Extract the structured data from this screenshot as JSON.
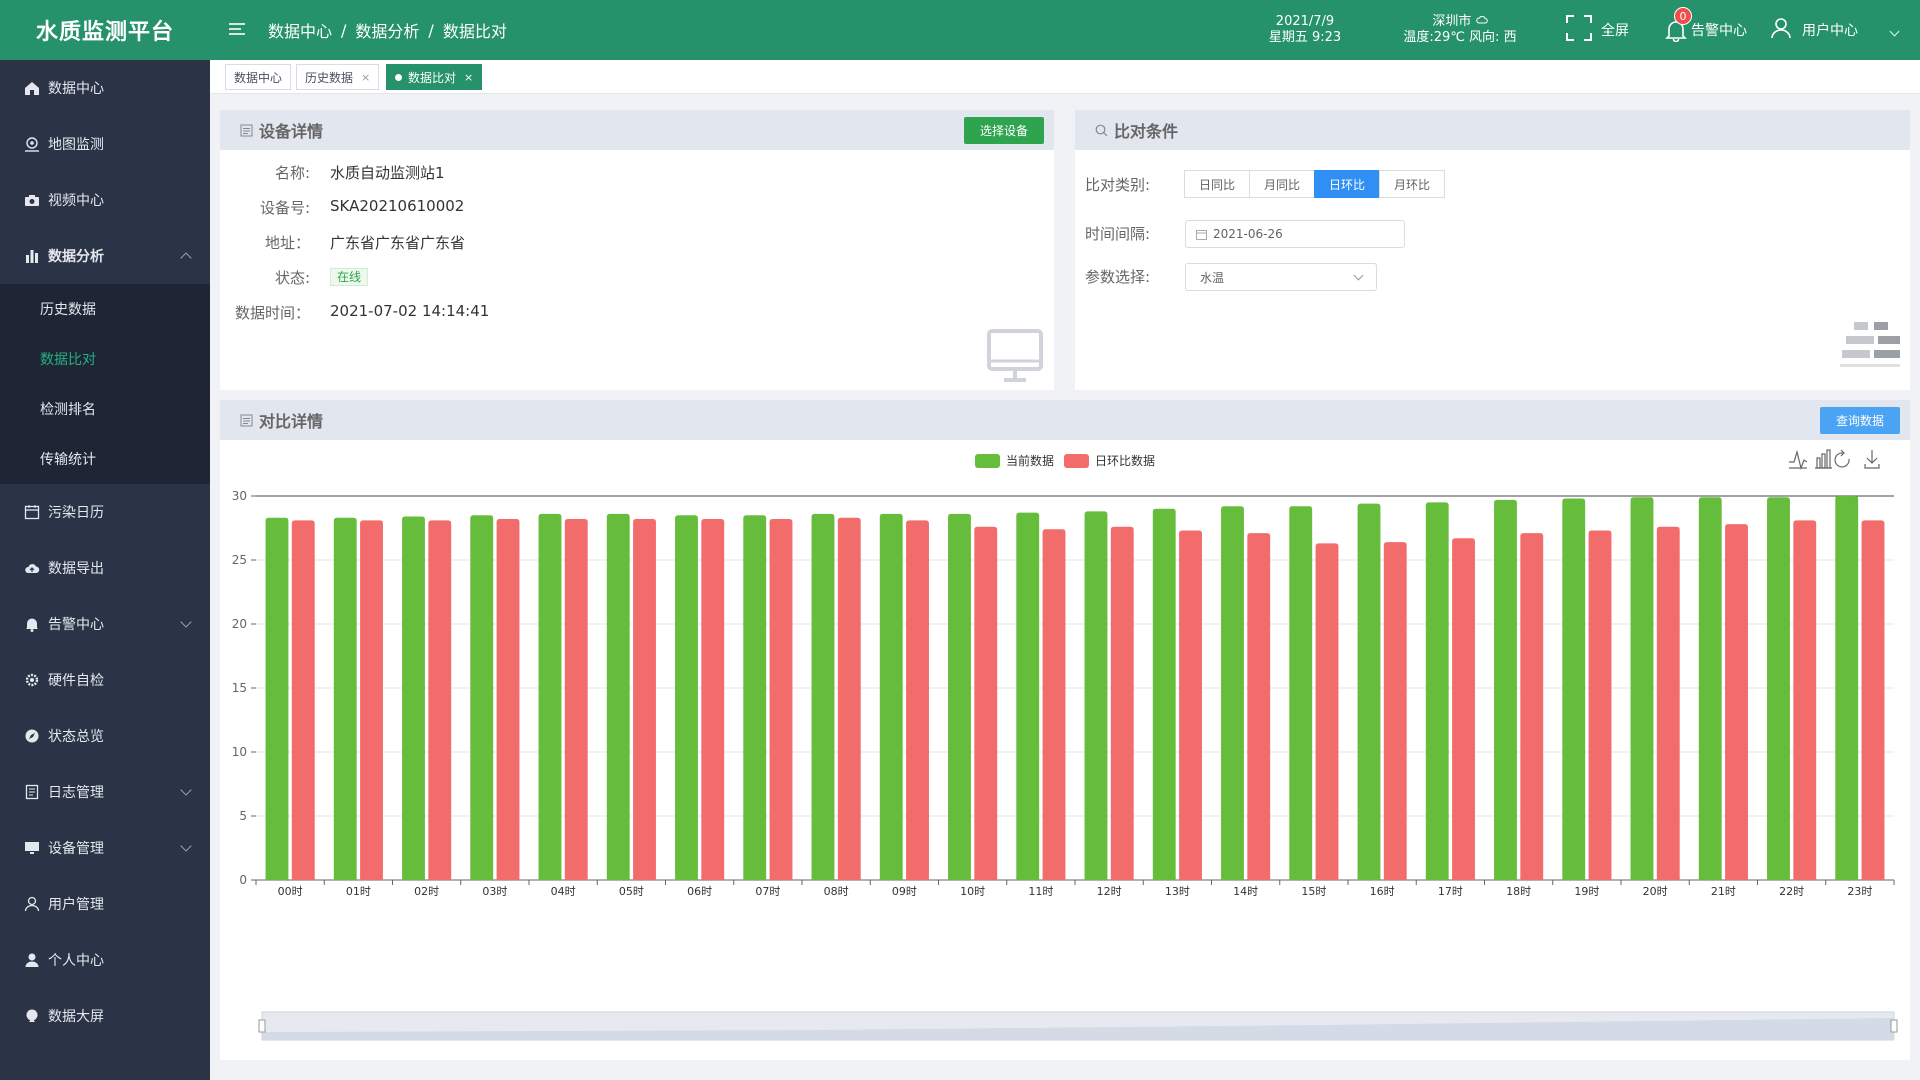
{
  "app": {
    "title": "水质监测平台"
  },
  "sidebar": {
    "items": [
      {
        "label": "数据中心",
        "icon": "home-icon"
      },
      {
        "label": "地图监测",
        "icon": "map-pin-icon"
      },
      {
        "label": "视频中心",
        "icon": "camera-icon"
      },
      {
        "label": "数据分析",
        "icon": "bar-chart-icon",
        "expanded": true
      },
      {
        "label": "污染日历",
        "icon": "calendar-icon"
      },
      {
        "label": "数据导出",
        "icon": "cloud-upload-icon"
      },
      {
        "label": "告警中心",
        "icon": "bell-icon"
      },
      {
        "label": "硬件自检",
        "icon": "gear-icon"
      },
      {
        "label": "状态总览",
        "icon": "compass-icon"
      },
      {
        "label": "日志管理",
        "icon": "document-icon"
      },
      {
        "label": "设备管理",
        "icon": "monitor-icon"
      },
      {
        "label": "用户管理",
        "icon": "user-icon"
      },
      {
        "label": "个人中心",
        "icon": "person-icon"
      },
      {
        "label": "数据大屏",
        "icon": "screen-icon"
      }
    ],
    "submenu": [
      {
        "label": "历史数据",
        "active": false
      },
      {
        "label": "数据比对",
        "active": true
      },
      {
        "label": "检测排名",
        "active": false
      },
      {
        "label": "传输统计",
        "active": false
      }
    ]
  },
  "header": {
    "breadcrumb": [
      "数据中心",
      "数据分析",
      "数据比对"
    ],
    "date": "2021/7/9",
    "weekday_time": "星期五 9:23",
    "city": "深圳市",
    "weather": "温度:29℃ 风向: 西",
    "fullscreen_label": "全屏",
    "alarm_label": "告警中心",
    "alarm_count": "0",
    "user_label": "用户中心"
  },
  "tabs": [
    {
      "label": "数据中心",
      "closable": false,
      "active": false
    },
    {
      "label": "历史数据",
      "closable": true,
      "active": false
    },
    {
      "label": "数据比对",
      "closable": true,
      "active": true
    }
  ],
  "device_panel": {
    "title": "设备详情",
    "select_button": "选择设备",
    "fields": [
      {
        "label": "名称:",
        "value": "水质自动监测站1"
      },
      {
        "label": "设备号:",
        "value": "SKA20210610002"
      },
      {
        "label": "地址：",
        "value": "广东省广东省广东省"
      },
      {
        "label": "状态:",
        "value": "在线"
      },
      {
        "label": "数据时间：",
        "value": "2021-07-02 14:14:41"
      }
    ]
  },
  "condition_panel": {
    "title": "比对条件",
    "type_label": "比对类别:",
    "type_options": [
      "日同比",
      "月同比",
      "日环比",
      "月环比"
    ],
    "type_selected": "日环比",
    "interval_label": "时间间隔:",
    "interval_value": "2021-06-26",
    "param_label": "参数选择:",
    "param_value": "水温"
  },
  "chart_panel": {
    "title": "对比详情",
    "query_button": "查询数据"
  },
  "colors": {
    "green": "#26926b",
    "current": "#66bd3b",
    "compare": "#f36c6c",
    "blue": "#2f8ff5"
  },
  "chart_data": {
    "type": "bar",
    "categories": [
      "00时",
      "01时",
      "02时",
      "03时",
      "04时",
      "05时",
      "06时",
      "07时",
      "08时",
      "09时",
      "10时",
      "11时",
      "12时",
      "13时",
      "14时",
      "15时",
      "16时",
      "17时",
      "18时",
      "19时",
      "20时",
      "21时",
      "22时",
      "23时"
    ],
    "series": [
      {
        "name": "当前数据",
        "color": "#66bd3b",
        "values": [
          28.3,
          28.3,
          28.4,
          28.5,
          28.6,
          28.6,
          28.5,
          28.5,
          28.6,
          28.6,
          28.6,
          28.7,
          28.8,
          29.0,
          29.2,
          29.2,
          29.4,
          29.5,
          29.7,
          29.8,
          29.9,
          29.9,
          29.9,
          30.0
        ]
      },
      {
        "name": "日环比数据",
        "color": "#f36c6c",
        "values": [
          28.1,
          28.1,
          28.1,
          28.2,
          28.2,
          28.2,
          28.2,
          28.2,
          28.3,
          28.1,
          27.6,
          27.4,
          27.6,
          27.3,
          27.1,
          26.3,
          26.4,
          26.7,
          27.1,
          27.3,
          27.6,
          27.8,
          28.1,
          28.1
        ]
      }
    ],
    "yticks": [
      "0",
      "5",
      "10",
      "15",
      "20",
      "25",
      "30"
    ],
    "ylim": [
      0,
      30
    ],
    "legend_position": "top-center",
    "grid": true
  }
}
